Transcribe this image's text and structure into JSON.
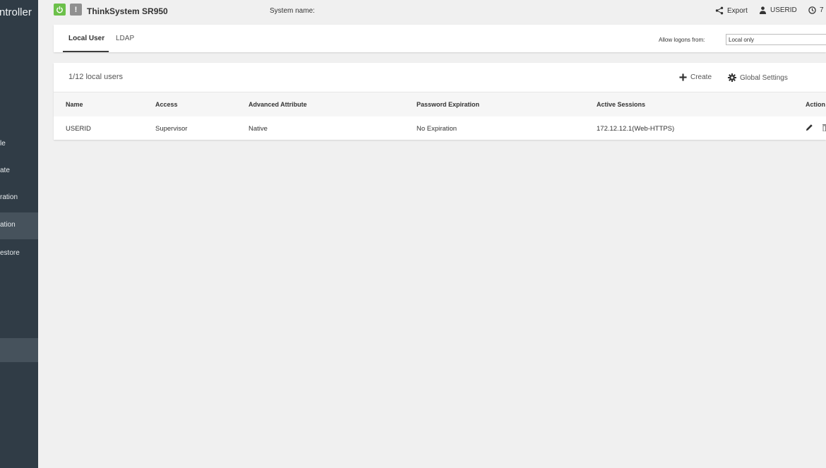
{
  "sidebar": {
    "brand": "ntroller",
    "items": [
      {
        "label": "le",
        "active": false
      },
      {
        "label": "ate",
        "active": false
      },
      {
        "label": "ration",
        "active": false
      },
      {
        "label": "ation",
        "active": true
      },
      {
        "label": "estore",
        "active": false
      }
    ]
  },
  "header": {
    "model": "ThinkSystem SR950",
    "system_name_label": "System name:",
    "export_label": "Export",
    "user_label": "USERID",
    "time_label": "7"
  },
  "tabs": {
    "items": [
      "Local User",
      "LDAP"
    ],
    "active": "Local User",
    "allow_logons_label": "Allow logons from:",
    "allow_logons_value": "Local only"
  },
  "users": {
    "count_label": "1/12  local users",
    "create_label": "Create",
    "global_settings_label": "Global Settings",
    "columns": [
      "Name",
      "Access",
      "Advanced Attribute",
      "Password Expiration",
      "Active Sessions",
      "Action"
    ],
    "rows": [
      {
        "name": "USERID",
        "access": "Supervisor",
        "advanced_attribute": "Native",
        "password_expiration": "No Expiration",
        "active_sessions": "172.12.12.1(Web-HTTPS)"
      }
    ]
  },
  "colors": {
    "sidebar_bg": "#303c46",
    "sidebar_active": "#46525c",
    "power_green": "#6cc04a",
    "page_bg": "#f0f0f0"
  },
  "icons": [
    "power-icon",
    "warning-icon",
    "share-icon",
    "user-icon",
    "clock-icon",
    "plus-icon",
    "gear-icon",
    "edit-icon",
    "delete-icon"
  ]
}
